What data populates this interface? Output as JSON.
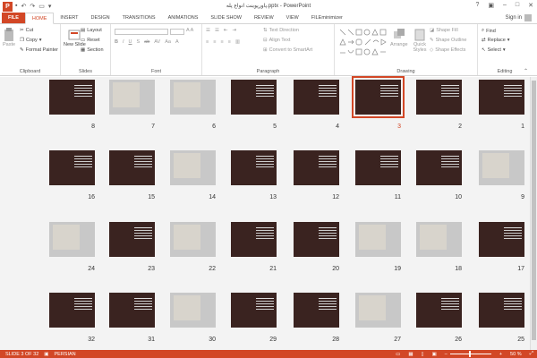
{
  "window": {
    "title": "پاورپوینت انواع پله.pptx - PowerPoint",
    "app_icon": "P"
  },
  "tabs": [
    "FILE",
    "HOME",
    "INSERT",
    "DESIGN",
    "TRANSITIONS",
    "ANIMATIONS",
    "SLIDE SHOW",
    "REVIEW",
    "VIEW",
    "FILEminimizer"
  ],
  "signin": "Sign in",
  "ribbon": {
    "clipboard": {
      "paste": "Paste",
      "cut": "Cut",
      "copy": "Copy",
      "format_painter": "Format Painter",
      "label": "Clipboard"
    },
    "slides": {
      "new_slide": "New Slide",
      "layout": "Layout",
      "reset": "Reset",
      "section": "Section",
      "label": "Slides"
    },
    "font": {
      "label": "Font"
    },
    "paragraph": {
      "text_direction": "Text Direction",
      "align_text": "Align Text",
      "convert_smartart": "Convert to SmartArt",
      "label": "Paragraph"
    },
    "drawing": {
      "arrange": "Arrange",
      "quick_styles": "Quick Styles",
      "shape_fill": "Shape Fill",
      "shape_outline": "Shape Outline",
      "shape_effects": "Shape Effects",
      "label": "Drawing"
    },
    "editing": {
      "find": "Find",
      "replace": "Replace",
      "select": "Select",
      "label": "Editing"
    }
  },
  "slides": [
    {
      "n": "8"
    },
    {
      "n": "7"
    },
    {
      "n": "6"
    },
    {
      "n": "5"
    },
    {
      "n": "4"
    },
    {
      "n": "3",
      "selected": true
    },
    {
      "n": "2"
    },
    {
      "n": "1"
    },
    {
      "n": "16"
    },
    {
      "n": "15"
    },
    {
      "n": "14"
    },
    {
      "n": "13"
    },
    {
      "n": "12"
    },
    {
      "n": "11"
    },
    {
      "n": "10"
    },
    {
      "n": "9"
    },
    {
      "n": "24"
    },
    {
      "n": "23"
    },
    {
      "n": "22"
    },
    {
      "n": "21"
    },
    {
      "n": "20"
    },
    {
      "n": "19"
    },
    {
      "n": "18"
    },
    {
      "n": "17"
    },
    {
      "n": "32"
    },
    {
      "n": "31"
    },
    {
      "n": "30"
    },
    {
      "n": "29"
    },
    {
      "n": "28"
    },
    {
      "n": "27"
    },
    {
      "n": "26"
    },
    {
      "n": "25"
    }
  ],
  "status": {
    "slide_info": "SLIDE 3 OF 32",
    "language": "PERSIAN",
    "zoom": "50 %"
  },
  "colors": {
    "accent": "#d24726",
    "slide_bg": "#3a2320"
  }
}
